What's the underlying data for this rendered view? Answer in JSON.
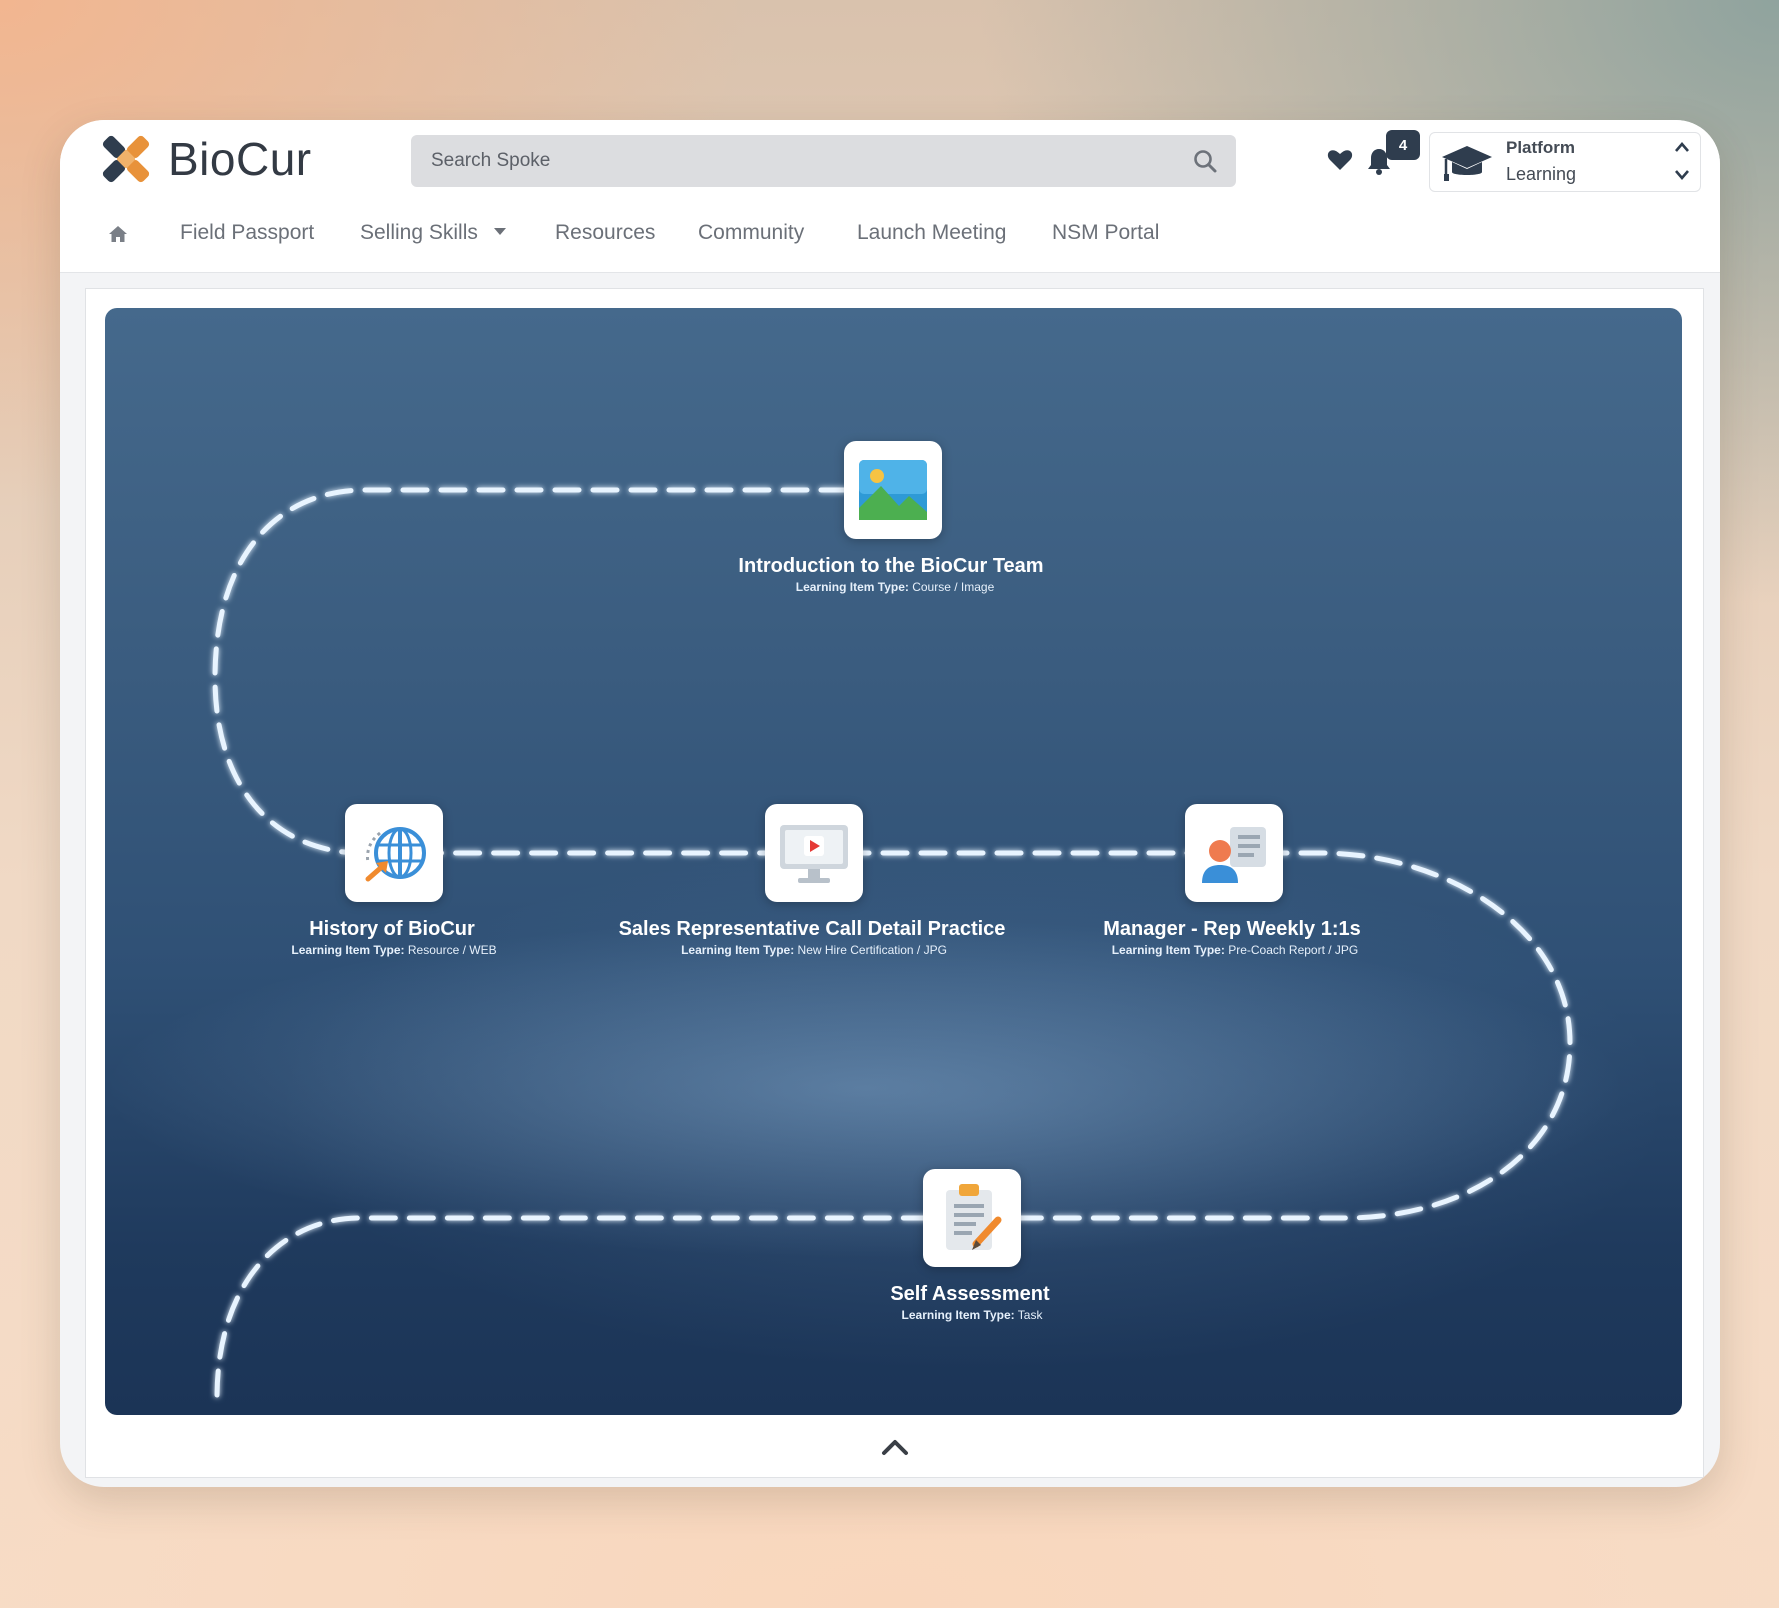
{
  "app": {
    "logo_text": "BioCur",
    "search_placeholder": "Search Spoke",
    "notification_count": "4",
    "selector": {
      "line1": "Platform",
      "line2": "Learning"
    }
  },
  "nav": {
    "items": [
      {
        "label": "Field Passport"
      },
      {
        "label": "Selling Skills",
        "has_dropdown": true
      },
      {
        "label": "Resources"
      },
      {
        "label": "Community"
      },
      {
        "label": "Launch Meeting"
      },
      {
        "label": "NSM Portal"
      }
    ]
  },
  "learning_path": {
    "type_prefix": "Learning Item Type:",
    "items": [
      {
        "title": "Introduction to the BioCur Team",
        "type": "Course / Image",
        "icon": "image-icon"
      },
      {
        "title": "History of BioCur",
        "type": "Resource / WEB",
        "icon": "web-globe-icon"
      },
      {
        "title": "Sales Representative Call Detail Practice",
        "type": "New Hire Certification / JPG",
        "icon": "video-monitor-icon"
      },
      {
        "title": "Manager - Rep Weekly 1:1s",
        "type": "Pre-Coach Report / JPG",
        "icon": "contact-card-icon"
      },
      {
        "title": "Self Assessment",
        "type": "Task",
        "icon": "clipboard-edit-icon"
      }
    ]
  },
  "colors": {
    "brand_orange": "#e8923a",
    "brand_navy": "#2f3d4e",
    "path_dash": "#e8f4ff",
    "background_top": "#45698c",
    "background_bottom": "#1b3456"
  }
}
